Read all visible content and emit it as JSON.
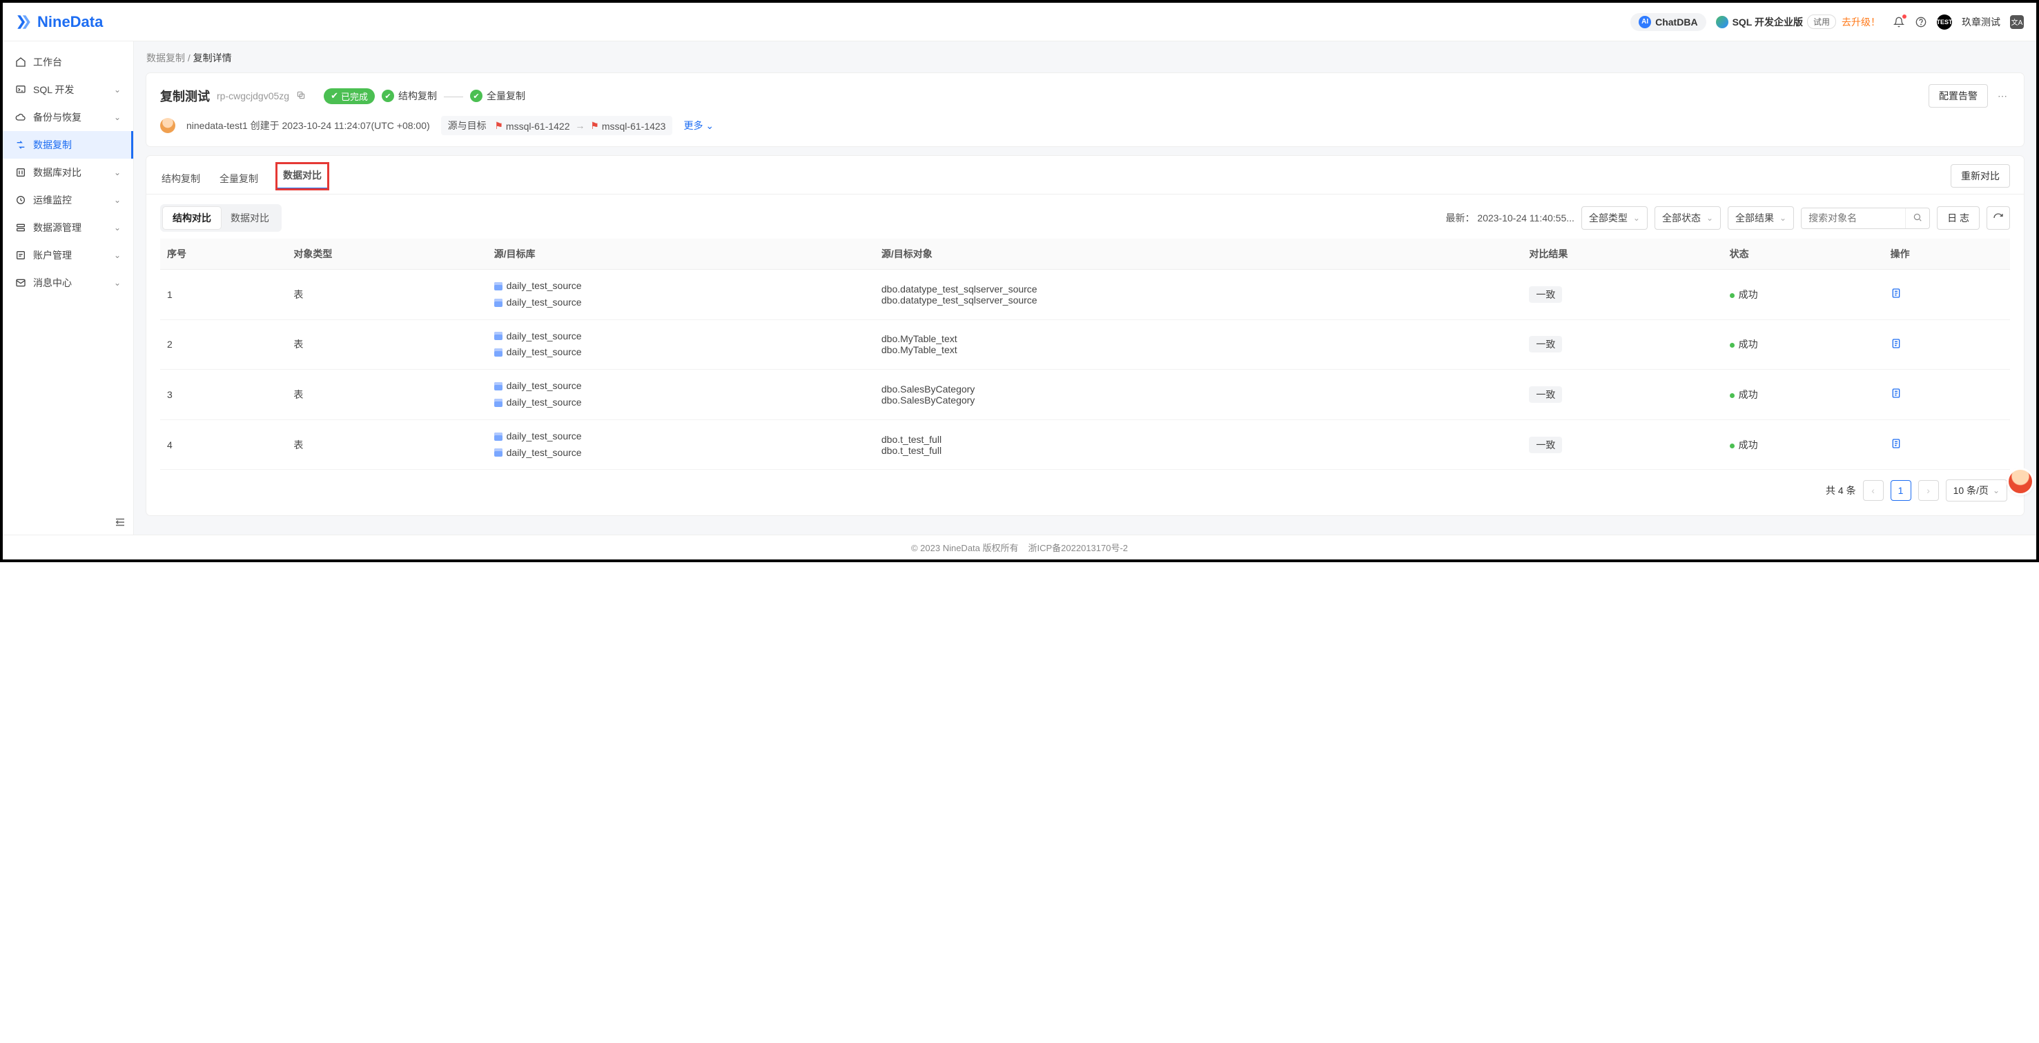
{
  "brand": "NineData",
  "topbar": {
    "chatdba": "ChatDBA",
    "product": "SQL 开发企业版",
    "trial": "试用",
    "upgrade": "去升级！",
    "username": "玖章测试",
    "test_badge": "TEST"
  },
  "sidebar": {
    "items": [
      {
        "label": "工作台",
        "expandable": false
      },
      {
        "label": "SQL 开发",
        "expandable": true
      },
      {
        "label": "备份与恢复",
        "expandable": true
      },
      {
        "label": "数据复制",
        "expandable": false,
        "active": true
      },
      {
        "label": "数据库对比",
        "expandable": true
      },
      {
        "label": "运维监控",
        "expandable": true
      },
      {
        "label": "数据源管理",
        "expandable": true
      },
      {
        "label": "账户管理",
        "expandable": true
      },
      {
        "label": "消息中心",
        "expandable": true
      }
    ]
  },
  "breadcrumb": {
    "parent": "数据复制",
    "sep": "/",
    "current": "复制详情"
  },
  "header_card": {
    "title": "复制测试",
    "rpid": "rp-cwgcjdgv05zg",
    "status": "已完成",
    "step1": "结构复制",
    "step2": "全量复制",
    "config_alert": "配置告警",
    "creator": "ninedata-test1 创建于 2023-10-24 11:24:07(UTC +08:00)",
    "srcdst_label": "源与目标",
    "src": "mssql-61-1422",
    "dst": "mssql-61-1423",
    "more": "更多"
  },
  "tabs": {
    "t1": "结构复制",
    "t2": "全量复制",
    "t3": "数据对比",
    "recompare": "重新对比"
  },
  "subtabs": {
    "s1": "结构对比",
    "s2": "数据对比"
  },
  "filters": {
    "latest_label": "最新：",
    "latest_time": "2023-10-24 11:40:55...",
    "all_type": "全部类型",
    "all_status": "全部状态",
    "all_result": "全部结果",
    "search_placeholder": "搜索对象名",
    "log_btn": "日 志"
  },
  "table": {
    "cols": {
      "idx": "序号",
      "objtype": "对象类型",
      "srcdst_db": "源/目标库",
      "srcdst_obj": "源/目标对象",
      "result": "对比结果",
      "status": "状态",
      "ops": "操作"
    },
    "rows": [
      {
        "idx": "1",
        "objtype": "表",
        "db_src": "daily_test_source",
        "db_dst": "daily_test_source",
        "obj_src": "dbo.datatype_test_sqlserver_source",
        "obj_dst": "dbo.datatype_test_sqlserver_source",
        "result": "一致",
        "status": "成功"
      },
      {
        "idx": "2",
        "objtype": "表",
        "db_src": "daily_test_source",
        "db_dst": "daily_test_source",
        "obj_src": "dbo.MyTable_text",
        "obj_dst": "dbo.MyTable_text",
        "result": "一致",
        "status": "成功"
      },
      {
        "idx": "3",
        "objtype": "表",
        "db_src": "daily_test_source",
        "db_dst": "daily_test_source",
        "obj_src": "dbo.SalesByCategory",
        "obj_dst": "dbo.SalesByCategory",
        "result": "一致",
        "status": "成功"
      },
      {
        "idx": "4",
        "objtype": "表",
        "db_src": "daily_test_source",
        "db_dst": "daily_test_source",
        "obj_src": "dbo.t_test_full",
        "obj_dst": "dbo.t_test_full",
        "result": "一致",
        "status": "成功"
      }
    ]
  },
  "pager": {
    "total": "共 4 条",
    "page": "1",
    "size": "10 条/页"
  },
  "footer": {
    "copyright": "© 2023 NineData 版权所有",
    "icp": "浙ICP备2022013170号-2"
  }
}
